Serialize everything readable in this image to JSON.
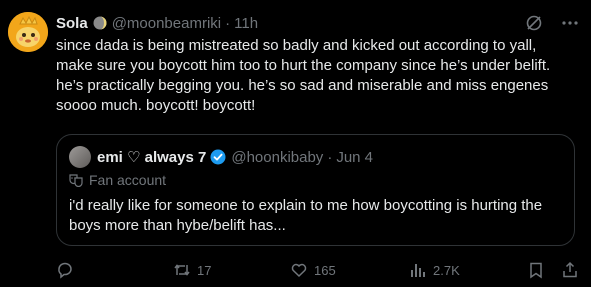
{
  "tweet": {
    "author_name": "Sola",
    "author_handle": "@moonbeamriki",
    "time": "11h",
    "text": "since dada is being mistreated so badly and kicked out according to yall,\nmake sure you boycott him too to hurt the company since he’s under belift.\nhe’s practically begging you. he’s so sad and miserable and miss engenes\nsoooo much. boycott! boycott!"
  },
  "quote": {
    "author_name": "emi ♡ always 7",
    "author_handle": "@hoonkibaby",
    "time": "Jun 4",
    "label": "Fan account",
    "text": "i'd really like for someone to explain to me how boycotting is hurting the boys more than hybe/belift has..."
  },
  "actions": {
    "retweets": "17",
    "likes": "165",
    "views": "2.7K"
  },
  "colors": {
    "background": "#000000",
    "text": "#e7e9ea",
    "muted": "#71767b",
    "border": "#2f3336",
    "verified": "#1d9bf0"
  }
}
